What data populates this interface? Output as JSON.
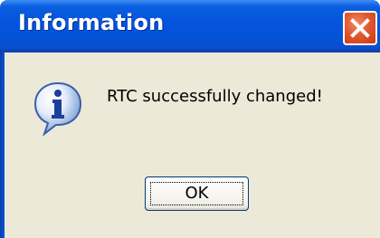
{
  "window": {
    "title": "Information",
    "close_icon": "close-icon"
  },
  "dialog": {
    "icon": "information-icon",
    "message": "RTC successfully changed!",
    "ok_label": "OK"
  },
  "colors": {
    "titlebar": "#0454dd",
    "client_background": "#ece9d8",
    "close_button": "#e2582e"
  }
}
